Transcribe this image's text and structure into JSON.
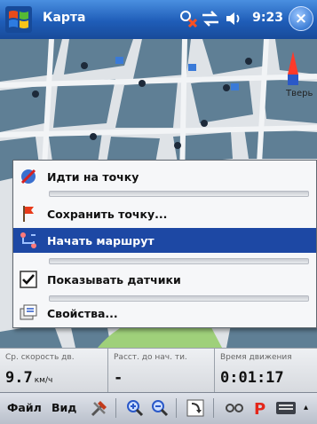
{
  "title_bar": {
    "app_title": "Карта",
    "clock": "9:23",
    "close_label": "×",
    "icons": [
      "windows-start-icon",
      "sync-error-icon",
      "connectivity-icon",
      "volume-icon"
    ]
  },
  "map": {
    "colors": {
      "blocks": "#5f7f95",
      "streets": "#dfe3e7",
      "park": "#9fd07a"
    },
    "poi_icons": [
      "parking-icon",
      "monument-icon",
      "hotel-icon",
      "bus-icon"
    ],
    "labels": {
      "top_right": "Тверь"
    }
  },
  "context_menu": {
    "items": [
      {
        "label": "Идти на точку",
        "icon": "globe-pin-icon",
        "selected": false
      },
      {
        "label": "Сохранить точку...",
        "icon": "flag-icon",
        "selected": false
      },
      {
        "label": "Начать маршрут",
        "icon": "route-icon",
        "selected": true
      },
      {
        "label": "Показывать датчики",
        "icon": "checkbox-icon",
        "selected": false,
        "checked": true
      },
      {
        "label": "Свойства...",
        "icon": "properties-icon",
        "selected": false
      }
    ]
  },
  "status": {
    "avg_speed": {
      "label": "Ср. скорость дв.",
      "value": "9.7",
      "unit": "км/ч"
    },
    "dist": {
      "label": "Расст. до нач. ти.",
      "value": "-"
    },
    "time": {
      "label": "Время движения",
      "value": "0:01:17"
    }
  },
  "menubar": {
    "file": "Файл",
    "view": "Вид",
    "icons": [
      "tools-icon",
      "zoom-in-icon",
      "zoom-out-icon",
      "rotate-map-icon",
      "track-icon",
      "parking-icon",
      "keyboard-icon"
    ],
    "more": "▴"
  }
}
